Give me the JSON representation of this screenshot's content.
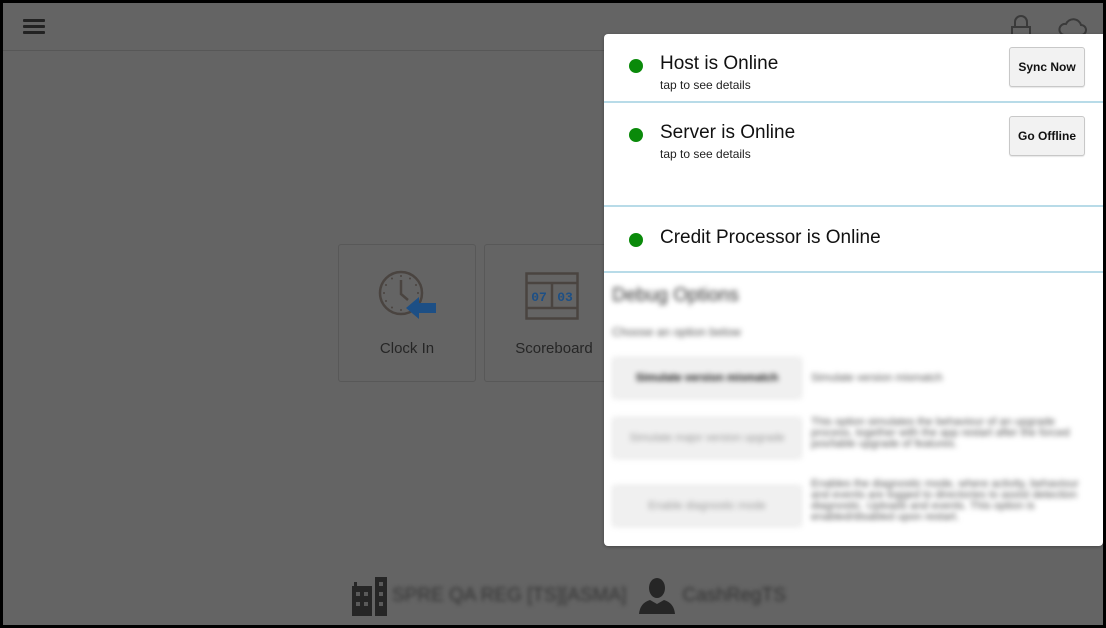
{
  "topbar": {
    "menu_icon": "hamburger-icon",
    "lock_icon": "lock-icon",
    "cloud_icon": "cloud-icon"
  },
  "tiles": [
    {
      "label": "Clock In",
      "icon": "clock-in-icon"
    },
    {
      "label": "Scoreboard",
      "icon": "scoreboard-icon",
      "digits_left": "07",
      "digits_right": "03"
    }
  ],
  "footer": {
    "location_icon": "building-icon",
    "location": "SPRE QA REG [TS][ASMA]",
    "user_icon": "user-icon",
    "user": "CashRegTS"
  },
  "status_popover": {
    "items": [
      {
        "title": "Host is Online",
        "subtitle": "tap to see details",
        "button": "Sync Now",
        "status": "online"
      },
      {
        "title": "Server is Online",
        "subtitle": "tap to see details",
        "button": "Go Offline",
        "status": "online"
      },
      {
        "title": "Credit Processor is Online",
        "status": "online"
      }
    ],
    "debug": {
      "title": "Debug Options",
      "subtitle": "Choose an option below",
      "options": [
        {
          "button": "Simulate version mismatch",
          "description": "Simulate version mismatch"
        },
        {
          "button": "Simulate major version upgrade",
          "description": "This option simulates the behaviour of an upgrade process, together with the app restart after the forced pos/table upgrade of features."
        },
        {
          "button": "Enable diagnostic mode",
          "description": "Enables the diagnostic mode, where activity, behaviour and events are logged to directories to assist detection diagnostic. Uploads and events. This option is enabled/disabled upon restart."
        }
      ]
    }
  },
  "colors": {
    "online": "#0a8a0a",
    "divider": "#b8dbe8",
    "accent_blue": "#1d4f85",
    "overlay": "#646464"
  }
}
